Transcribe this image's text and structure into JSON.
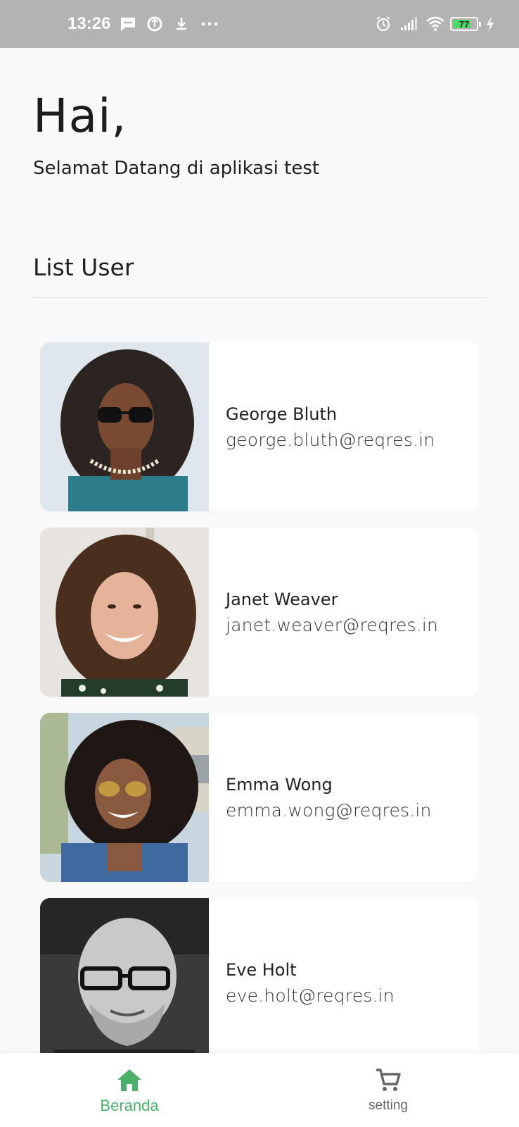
{
  "status_bar": {
    "time": "13:26",
    "battery_level": "77",
    "battery_fraction": 0.77,
    "icons_left": [
      "message-icon",
      "sync-icon",
      "download-icon",
      "more-dots-icon"
    ],
    "icons_right": [
      "alarm-icon",
      "signal-icon",
      "wifi-icon",
      "battery-icon",
      "charging-icon"
    ]
  },
  "header": {
    "greeting": "Hai,",
    "welcome": "Selamat Datang di aplikasi test"
  },
  "section": {
    "title": "List User"
  },
  "users": [
    {
      "name": "George Bluth",
      "email": "george.bluth@reqres.in"
    },
    {
      "name": "Janet Weaver",
      "email": "janet.weaver@reqres.in"
    },
    {
      "name": "Emma Wong",
      "email": "emma.wong@reqres.in"
    },
    {
      "name": "Eve Holt",
      "email": "eve.holt@reqres.in"
    }
  ],
  "bottom_nav": {
    "items": [
      {
        "label": "Beranda",
        "icon": "home-icon",
        "active": true
      },
      {
        "label": "setting",
        "icon": "cart-icon",
        "active": false
      }
    ]
  },
  "colors": {
    "accent": "#4caf6a",
    "background": "#f9f9f9",
    "status_bar": "#b3b3b3"
  }
}
